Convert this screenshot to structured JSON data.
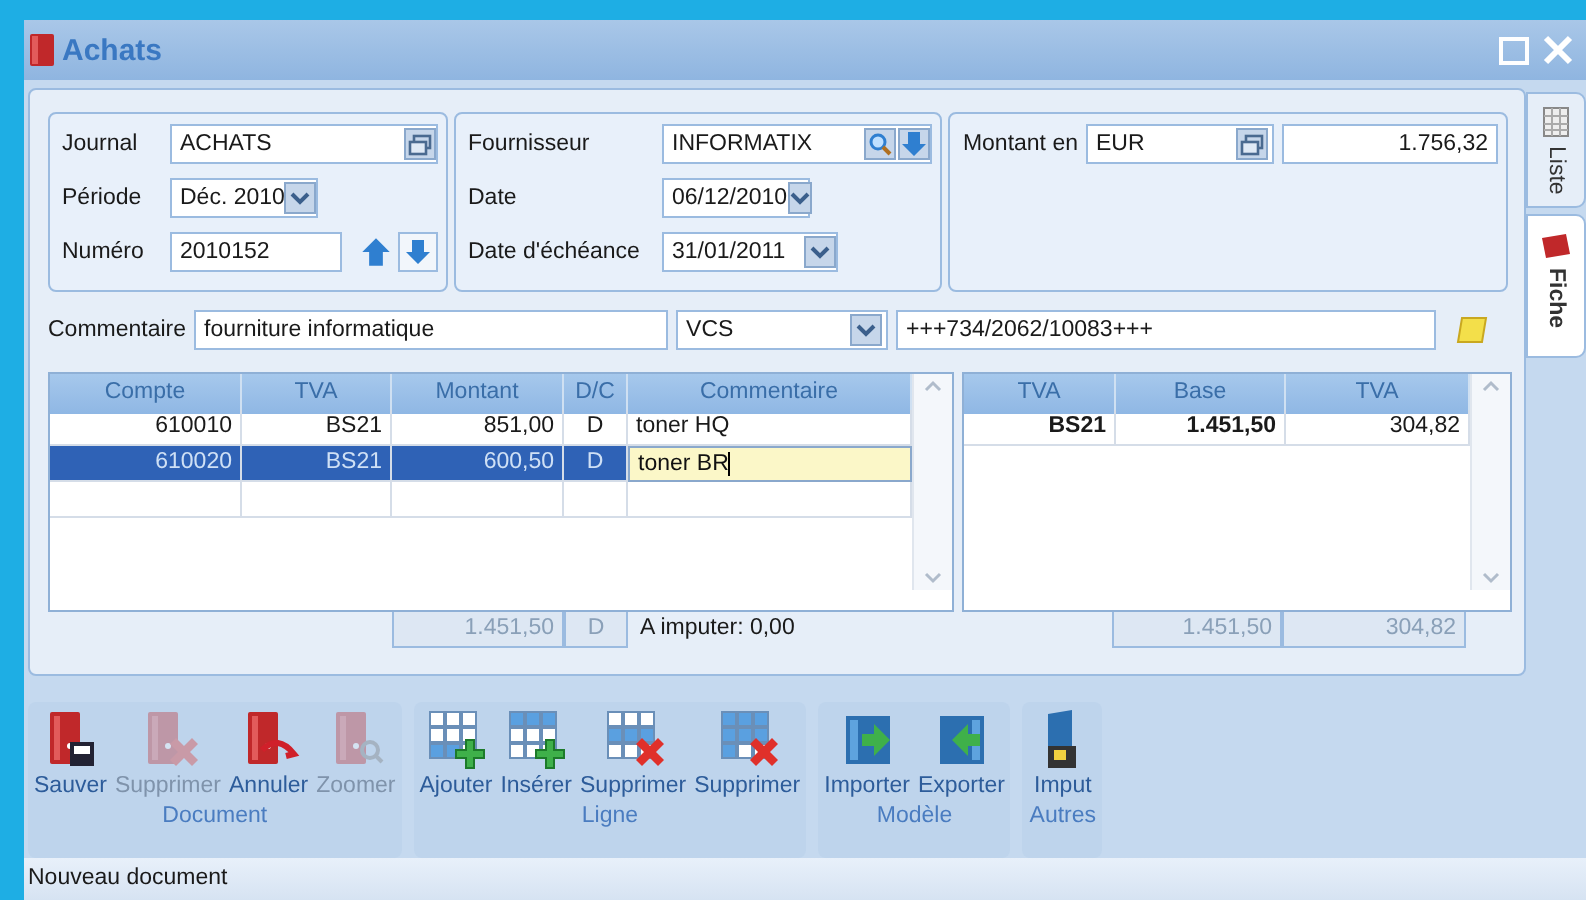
{
  "window": {
    "title": "Achats"
  },
  "journal_group": {
    "fields": [
      {
        "label": "Journal",
        "value": "ACHATS",
        "kind": "lookup"
      },
      {
        "label": "Période",
        "value": "Déc. 2010",
        "kind": "select"
      },
      {
        "label": "Numéro",
        "value": "2010152",
        "kind": "stepper"
      }
    ]
  },
  "supplier_group": {
    "fields": [
      {
        "label": "Fournisseur",
        "value": "INFORMATIX",
        "kind": "search"
      },
      {
        "label": "Date",
        "value": "06/12/2010",
        "kind": "select"
      },
      {
        "label": "Date d'échéance",
        "value": "31/01/2011",
        "kind": "select"
      }
    ]
  },
  "amount_group": {
    "label": "Montant en",
    "currency": "EUR",
    "amount": "1.756,32"
  },
  "comment_row": {
    "label": "Commentaire",
    "value": "fourniture informatique",
    "reference_type": "VCS",
    "reference": "+++734/2062/10083+++"
  },
  "lines": {
    "columns": [
      "Compte",
      "TVA",
      "Montant",
      "D/C",
      "Commentaire"
    ],
    "rows": [
      {
        "cells": [
          "610010",
          "BS21",
          "851,00",
          "D",
          "toner HQ"
        ],
        "selected": false,
        "editing": false
      },
      {
        "cells": [
          "610020",
          "BS21",
          "600,50",
          "D",
          "toner BR"
        ],
        "selected": true,
        "editing": true
      },
      {
        "cells": [],
        "selected": false,
        "editing": false
      }
    ],
    "totals": {
      "amount": "1.451,50",
      "dc": "D",
      "remaining": "A imputer: 0,00"
    }
  },
  "vat": {
    "columns": [
      "TVA",
      "Base",
      "TVA"
    ],
    "rows": [
      {
        "cells": [
          "BS21",
          "1.451,50",
          "304,82"
        ]
      }
    ],
    "totals": [
      "1.451,50",
      "304,82"
    ]
  },
  "side_tabs": [
    {
      "label": "Liste",
      "selected": false,
      "kind": "grid"
    },
    {
      "label": "Fiche",
      "selected": true,
      "kind": "card"
    }
  ],
  "toolbar": [
    {
      "label": "Document",
      "buttons": [
        {
          "label": "Sauver",
          "kind": "save",
          "disabled": false
        },
        {
          "label": "Supprimer",
          "kind": "delete",
          "disabled": true
        },
        {
          "label": "Annuler",
          "kind": "undo",
          "disabled": false
        },
        {
          "label": "Zoomer",
          "kind": "zoom",
          "disabled": true
        }
      ]
    },
    {
      "label": "Ligne",
      "buttons": [
        {
          "label": "Ajouter",
          "kind": "add-row",
          "disabled": false
        },
        {
          "label": "Insérer",
          "kind": "insert-row",
          "disabled": false
        },
        {
          "label": "Supprimer",
          "kind": "delete-row",
          "disabled": false
        },
        {
          "label": "Supprimer",
          "kind": "delete-rows",
          "disabled": false
        }
      ]
    },
    {
      "label": "Modèle",
      "buttons": [
        {
          "label": "Importer",
          "kind": "import",
          "disabled": false
        },
        {
          "label": "Exporter",
          "kind": "export",
          "disabled": false
        }
      ]
    },
    {
      "label": "Autres",
      "buttons": [
        {
          "label": "Imput",
          "kind": "imput",
          "disabled": false
        }
      ]
    }
  ],
  "status_bar": "Nouveau document"
}
